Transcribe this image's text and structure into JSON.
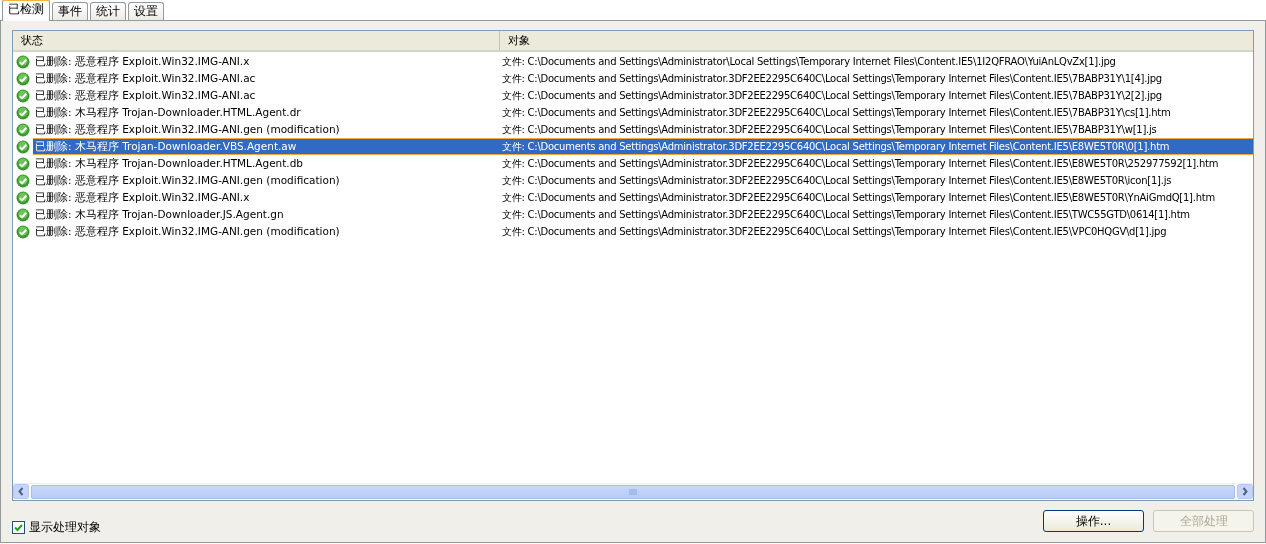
{
  "tabs": [
    {
      "label": "已检测",
      "selected": true
    },
    {
      "label": "事件",
      "selected": false
    },
    {
      "label": "统计",
      "selected": false
    },
    {
      "label": "设置",
      "selected": false
    }
  ],
  "table": {
    "columns": [
      "状态",
      "对象"
    ],
    "rows": [
      {
        "status": "已删除: 恶意程序 Exploit.Win32.IMG-ANI.x",
        "object": "文件: C:\\Documents and Settings\\Administrator\\Local Settings\\Temporary Internet Files\\Content.IE5\\1I2QFRAO\\YuiAnLQvZx[1].jpg",
        "selected": false
      },
      {
        "status": "已删除: 恶意程序 Exploit.Win32.IMG-ANI.ac",
        "object": "文件: C:\\Documents and Settings\\Administrator.3DF2EE2295C640C\\Local Settings\\Temporary Internet Files\\Content.IE5\\7BABP31Y\\1[4].jpg",
        "selected": false
      },
      {
        "status": "已删除: 恶意程序 Exploit.Win32.IMG-ANI.ac",
        "object": "文件: C:\\Documents and Settings\\Administrator.3DF2EE2295C640C\\Local Settings\\Temporary Internet Files\\Content.IE5\\7BABP31Y\\2[2].jpg",
        "selected": false
      },
      {
        "status": "已删除: 木马程序 Trojan-Downloader.HTML.Agent.dr",
        "object": "文件: C:\\Documents and Settings\\Administrator.3DF2EE2295C640C\\Local Settings\\Temporary Internet Files\\Content.IE5\\7BABP31Y\\cs[1].htm",
        "selected": false
      },
      {
        "status": "已删除: 恶意程序 Exploit.Win32.IMG-ANI.gen (modification)",
        "object": "文件: C:\\Documents and Settings\\Administrator.3DF2EE2295C640C\\Local Settings\\Temporary Internet Files\\Content.IE5\\7BABP31Y\\w[1].js",
        "selected": false
      },
      {
        "status": "已删除: 木马程序 Trojan-Downloader.VBS.Agent.aw",
        "object": "文件: C:\\Documents and Settings\\Administrator.3DF2EE2295C640C\\Local Settings\\Temporary Internet Files\\Content.IE5\\E8WE5T0R\\0[1].htm",
        "selected": true
      },
      {
        "status": "已删除: 木马程序 Trojan-Downloader.HTML.Agent.db",
        "object": "文件: C:\\Documents and Settings\\Administrator.3DF2EE2295C640C\\Local Settings\\Temporary Internet Files\\Content.IE5\\E8WE5T0R\\252977592[1].htm",
        "selected": false
      },
      {
        "status": "已删除: 恶意程序 Exploit.Win32.IMG-ANI.gen (modification)",
        "object": "文件: C:\\Documents and Settings\\Administrator.3DF2EE2295C640C\\Local Settings\\Temporary Internet Files\\Content.IE5\\E8WE5T0R\\icon[1].js",
        "selected": false
      },
      {
        "status": "已删除: 恶意程序 Exploit.Win32.IMG-ANI.x",
        "object": "文件: C:\\Documents and Settings\\Administrator.3DF2EE2295C640C\\Local Settings\\Temporary Internet Files\\Content.IE5\\E8WE5T0R\\YnAiGmdQ[1].htm",
        "selected": false
      },
      {
        "status": "已删除: 木马程序 Trojan-Downloader.JS.Agent.gn",
        "object": "文件: C:\\Documents and Settings\\Administrator.3DF2EE2295C640C\\Local Settings\\Temporary Internet Files\\Content.IE5\\TWC55GTD\\0614[1].htm",
        "selected": false
      },
      {
        "status": "已删除: 恶意程序 Exploit.Win32.IMG-ANI.gen (modification)",
        "object": "文件: C:\\Documents and Settings\\Administrator.3DF2EE2295C640C\\Local Settings\\Temporary Internet Files\\Content.IE5\\VPC0HQGV\\d[1].jpg",
        "selected": false
      }
    ]
  },
  "show_processed": {
    "label": "显示处理对象",
    "checked": true
  },
  "buttons": [
    {
      "label": "操作...",
      "disabled": false
    },
    {
      "label": "全部处理",
      "disabled": true
    }
  ]
}
